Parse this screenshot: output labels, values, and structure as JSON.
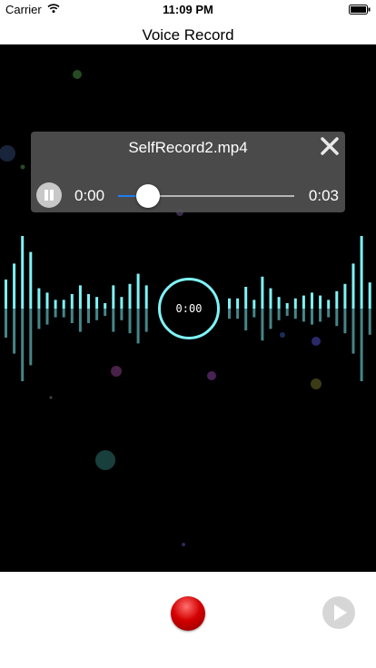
{
  "status_bar": {
    "carrier": "Carrier",
    "time": "11:09 PM",
    "wifi_icon": "wifi-icon",
    "battery_icon": "battery-icon"
  },
  "nav": {
    "title": "Voice Record"
  },
  "player": {
    "file_name": "SelfRecord2.mp4",
    "current_time": "0:00",
    "duration": "0:03",
    "progress": 0.17,
    "close_icon": "close-icon",
    "pause_icon": "pause-icon"
  },
  "recorder": {
    "elapsed": "0:00",
    "waveform_levels": [
      0.4,
      0.62,
      1.0,
      0.78,
      0.28,
      0.22,
      0.12,
      0.12,
      0.2,
      0.32,
      0.2,
      0.16,
      0.06,
      0.32,
      0.16,
      0.34,
      0.48,
      0.32,
      0.14,
      0.14,
      0.3,
      0.12,
      0.44,
      0.28,
      0.16,
      0.06,
      0.14,
      0.18,
      0.22,
      0.18,
      0.12,
      0.24,
      0.34,
      0.62,
      1.0,
      0.36
    ],
    "accent_color": "#7ff3f7"
  },
  "toolbar": {
    "record_icon": "record-icon",
    "play_icon": "play-icon"
  }
}
